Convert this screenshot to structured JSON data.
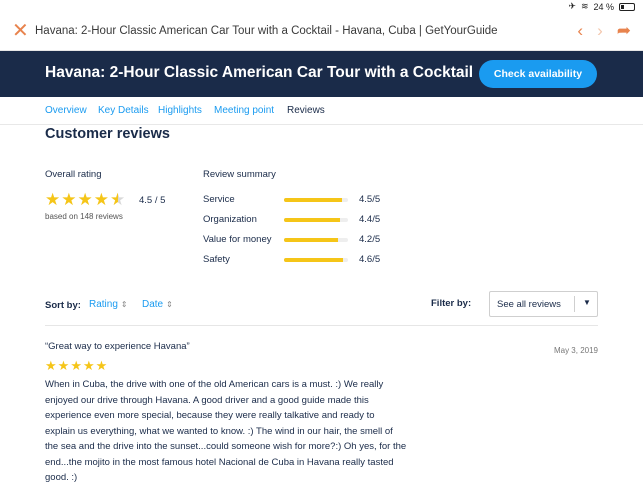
{
  "status": {
    "battery": "24 %"
  },
  "browser": {
    "page_title": "Havana: 2-Hour Classic American Car Tour with a Cocktail - Havana, Cuba | GetYourGuide",
    "accent_color": "#e8834d"
  },
  "header": {
    "title": "Havana: 2-Hour Classic American Car Tour with a Cocktail",
    "cta_label": "Check availability",
    "bg_color": "#1a2b49",
    "cta_color": "#1a9bf0"
  },
  "tabs": [
    {
      "label": "Overview",
      "active": false
    },
    {
      "label": "Key Details",
      "active": false
    },
    {
      "label": "Highlights",
      "active": false
    },
    {
      "label": "Meeting point",
      "active": false
    },
    {
      "label": "Reviews",
      "active": true
    }
  ],
  "reviews": {
    "section_title": "Customer reviews",
    "overall": {
      "label": "Overall rating",
      "rating": 4.5,
      "score_text": "4.5 / 5",
      "count_text": "based on 148 reviews"
    },
    "summary": {
      "label": "Review summary",
      "rows": [
        {
          "label": "Service",
          "value": 4.5,
          "value_text": "4.5/5"
        },
        {
          "label": "Organization",
          "value": 4.4,
          "value_text": "4.4/5"
        },
        {
          "label": "Value for money",
          "value": 4.2,
          "value_text": "4.2/5"
        },
        {
          "label": "Safety",
          "value": 4.6,
          "value_text": "4.6/5"
        }
      ]
    },
    "sort": {
      "label": "Sort by:",
      "options": [
        "Rating",
        "Date"
      ]
    },
    "filter": {
      "label": "Filter by:",
      "selected": "See all reviews"
    },
    "items": [
      {
        "title": "“Great way to experience Havana”",
        "date": "May 3, 2019",
        "stars": 5,
        "body_lines": [
          "When in Cuba, the drive with one of the old American cars is a must. :) We really",
          "enjoyed our drive through Havana. A good driver and a good guide made this",
          "experience even more special, because they were really talkative and ready to",
          "explain us everything, what we wanted to know. :) The wind in our hair, the smell of",
          "the sea and the drive into the sunset...could someone wish for more?:) Oh yes, for the",
          "end...the mojito in the most famous hotel Nacional de Cuba in Havana really tasted",
          "good. :)"
        ]
      }
    ],
    "star_color": "#f5c518"
  }
}
